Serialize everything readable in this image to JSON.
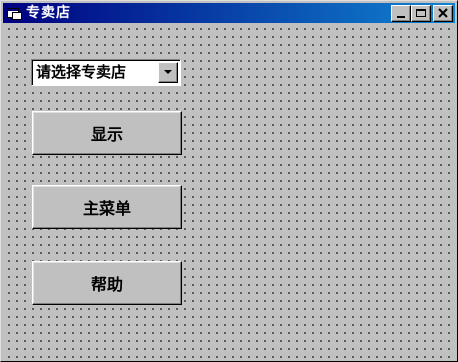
{
  "window": {
    "title": "专卖店",
    "colors": {
      "face": "#c0c0c0",
      "titlebar_start": "#000080",
      "titlebar_end": "#1084d0"
    }
  },
  "titlebar": {
    "buttons": [
      "minimize-icon",
      "maximize-icon",
      "close-icon"
    ]
  },
  "form": {
    "combo": {
      "selected": "请选择专卖店",
      "icon": "chevron-down-icon"
    },
    "buttons": {
      "show": "显示",
      "main_menu": "主菜单",
      "help": "帮助"
    }
  }
}
